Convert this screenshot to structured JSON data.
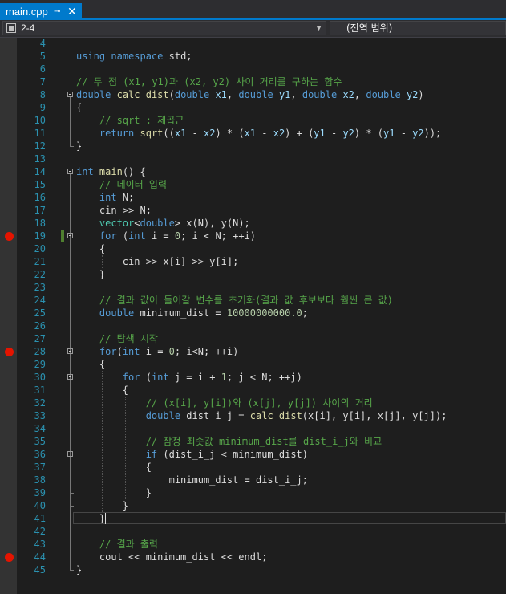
{
  "tab": {
    "title": "main.cpp",
    "pin_glyph": "⊸",
    "close_glyph": "✕"
  },
  "navigation": {
    "scope": "2-4",
    "member": "(전역 범위)"
  },
  "editor": {
    "breakpoint_lines": [
      19,
      28,
      44
    ],
    "changed_lines": [
      19
    ],
    "current_line": 41,
    "lines": [
      {
        "n": 4,
        "tokens": []
      },
      {
        "n": 5,
        "tokens": [
          [
            "kw",
            "using"
          ],
          [
            "t",
            " "
          ],
          [
            "kw",
            "namespace"
          ],
          [
            "t",
            " std;"
          ]
        ]
      },
      {
        "n": 6,
        "tokens": []
      },
      {
        "n": 7,
        "tokens": [
          [
            "cm",
            "// 두 점 (x1, y1)과 (x2, y2) 사이 거리를 구하는 함수"
          ]
        ]
      },
      {
        "n": 8,
        "tokens": [
          [
            "kw",
            "double"
          ],
          [
            "t",
            " "
          ],
          [
            "fn",
            "calc_dist"
          ],
          [
            "t",
            "("
          ],
          [
            "kw",
            "double"
          ],
          [
            "t",
            " "
          ],
          [
            "pm",
            "x1"
          ],
          [
            "t",
            ", "
          ],
          [
            "kw",
            "double"
          ],
          [
            "t",
            " "
          ],
          [
            "pm",
            "y1"
          ],
          [
            "t",
            ", "
          ],
          [
            "kw",
            "double"
          ],
          [
            "t",
            " "
          ],
          [
            "pm",
            "x2"
          ],
          [
            "t",
            ", "
          ],
          [
            "kw",
            "double"
          ],
          [
            "t",
            " "
          ],
          [
            "pm",
            "y2"
          ],
          [
            "t",
            ")"
          ]
        ]
      },
      {
        "n": 9,
        "tokens": [
          [
            "t",
            "{"
          ]
        ]
      },
      {
        "n": 10,
        "tokens": [
          [
            "t",
            "    "
          ],
          [
            "cm",
            "// sqrt : 제곱근"
          ]
        ]
      },
      {
        "n": 11,
        "tokens": [
          [
            "t",
            "    "
          ],
          [
            "kw",
            "return"
          ],
          [
            "t",
            " "
          ],
          [
            "fn",
            "sqrt"
          ],
          [
            "t",
            "(("
          ],
          [
            "pm",
            "x1"
          ],
          [
            "t",
            " - "
          ],
          [
            "pm",
            "x2"
          ],
          [
            "t",
            ") * ("
          ],
          [
            "pm",
            "x1"
          ],
          [
            "t",
            " - "
          ],
          [
            "pm",
            "x2"
          ],
          [
            "t",
            ") + ("
          ],
          [
            "pm",
            "y1"
          ],
          [
            "t",
            " - "
          ],
          [
            "pm",
            "y2"
          ],
          [
            "t",
            ") * ("
          ],
          [
            "pm",
            "y1"
          ],
          [
            "t",
            " - "
          ],
          [
            "pm",
            "y2"
          ],
          [
            "t",
            "));"
          ]
        ]
      },
      {
        "n": 12,
        "tokens": [
          [
            "t",
            "}"
          ]
        ]
      },
      {
        "n": 13,
        "tokens": []
      },
      {
        "n": 14,
        "tokens": [
          [
            "kw",
            "int"
          ],
          [
            "t",
            " "
          ],
          [
            "fn",
            "main"
          ],
          [
            "t",
            "() {"
          ]
        ]
      },
      {
        "n": 15,
        "tokens": [
          [
            "t",
            "    "
          ],
          [
            "cm",
            "// 데이터 입력"
          ]
        ]
      },
      {
        "n": 16,
        "tokens": [
          [
            "t",
            "    "
          ],
          [
            "kw",
            "int"
          ],
          [
            "t",
            " N;"
          ]
        ]
      },
      {
        "n": 17,
        "tokens": [
          [
            "t",
            "    cin >> N;"
          ]
        ]
      },
      {
        "n": 18,
        "tokens": [
          [
            "t",
            "    "
          ],
          [
            "ty",
            "vector"
          ],
          [
            "t",
            "<"
          ],
          [
            "kw",
            "double"
          ],
          [
            "t",
            "> x(N), y(N);"
          ]
        ]
      },
      {
        "n": 19,
        "tokens": [
          [
            "t",
            "    "
          ],
          [
            "kw",
            "for"
          ],
          [
            "t",
            " ("
          ],
          [
            "kw",
            "int"
          ],
          [
            "t",
            " i = "
          ],
          [
            "nm",
            "0"
          ],
          [
            "t",
            "; i < N; ++i)"
          ]
        ]
      },
      {
        "n": 20,
        "tokens": [
          [
            "t",
            "    {"
          ]
        ]
      },
      {
        "n": 21,
        "tokens": [
          [
            "t",
            "        cin >> x[i] >> y[i];"
          ]
        ]
      },
      {
        "n": 22,
        "tokens": [
          [
            "t",
            "    }"
          ]
        ]
      },
      {
        "n": 23,
        "tokens": []
      },
      {
        "n": 24,
        "tokens": [
          [
            "t",
            "    "
          ],
          [
            "cm",
            "// 결과 값이 들어갈 변수를 초기화(결과 값 후보보다 훨씬 큰 값)"
          ]
        ]
      },
      {
        "n": 25,
        "tokens": [
          [
            "t",
            "    "
          ],
          [
            "kw",
            "double"
          ],
          [
            "t",
            " minimum_dist = "
          ],
          [
            "nm",
            "10000000000.0"
          ],
          [
            "t",
            ";"
          ]
        ]
      },
      {
        "n": 26,
        "tokens": []
      },
      {
        "n": 27,
        "tokens": [
          [
            "t",
            "    "
          ],
          [
            "cm",
            "// 탐색 시작"
          ]
        ]
      },
      {
        "n": 28,
        "tokens": [
          [
            "t",
            "    "
          ],
          [
            "kw",
            "for"
          ],
          [
            "t",
            "("
          ],
          [
            "kw",
            "int"
          ],
          [
            "t",
            " i = "
          ],
          [
            "nm",
            "0"
          ],
          [
            "t",
            "; i<N; ++i)"
          ]
        ]
      },
      {
        "n": 29,
        "tokens": [
          [
            "t",
            "    {"
          ]
        ]
      },
      {
        "n": 30,
        "tokens": [
          [
            "t",
            "        "
          ],
          [
            "kw",
            "for"
          ],
          [
            "t",
            " ("
          ],
          [
            "kw",
            "int"
          ],
          [
            "t",
            " j = i + "
          ],
          [
            "nm",
            "1"
          ],
          [
            "t",
            "; j < N; ++j)"
          ]
        ]
      },
      {
        "n": 31,
        "tokens": [
          [
            "t",
            "        {"
          ]
        ]
      },
      {
        "n": 32,
        "tokens": [
          [
            "t",
            "            "
          ],
          [
            "cm",
            "// (x[i], y[i])와 (x[j], y[j]) 사이의 거리"
          ]
        ]
      },
      {
        "n": 33,
        "tokens": [
          [
            "t",
            "            "
          ],
          [
            "kw",
            "double"
          ],
          [
            "t",
            " dist_i_j = "
          ],
          [
            "fn",
            "calc_dist"
          ],
          [
            "t",
            "(x[i], y[i], x[j], y[j]);"
          ]
        ]
      },
      {
        "n": 34,
        "tokens": []
      },
      {
        "n": 35,
        "tokens": [
          [
            "t",
            "            "
          ],
          [
            "cm",
            "// 잠정 최솟값 minimum_dist를 dist_i_j와 비교"
          ]
        ]
      },
      {
        "n": 36,
        "tokens": [
          [
            "t",
            "            "
          ],
          [
            "kw",
            "if"
          ],
          [
            "t",
            " (dist_i_j < minimum_dist)"
          ]
        ]
      },
      {
        "n": 37,
        "tokens": [
          [
            "t",
            "            {"
          ]
        ]
      },
      {
        "n": 38,
        "tokens": [
          [
            "t",
            "                minimum_dist = dist_i_j;"
          ]
        ]
      },
      {
        "n": 39,
        "tokens": [
          [
            "t",
            "            }"
          ]
        ]
      },
      {
        "n": 40,
        "tokens": [
          [
            "t",
            "        }"
          ]
        ]
      },
      {
        "n": 41,
        "tokens": [
          [
            "t",
            "    }"
          ]
        ]
      },
      {
        "n": 42,
        "tokens": []
      },
      {
        "n": 43,
        "tokens": [
          [
            "t",
            "    "
          ],
          [
            "cm",
            "// 결과 출력"
          ]
        ]
      },
      {
        "n": 44,
        "tokens": [
          [
            "t",
            "    cout << minimum_dist << endl;"
          ]
        ]
      },
      {
        "n": 45,
        "tokens": [
          [
            "t",
            "}"
          ]
        ]
      }
    ]
  }
}
